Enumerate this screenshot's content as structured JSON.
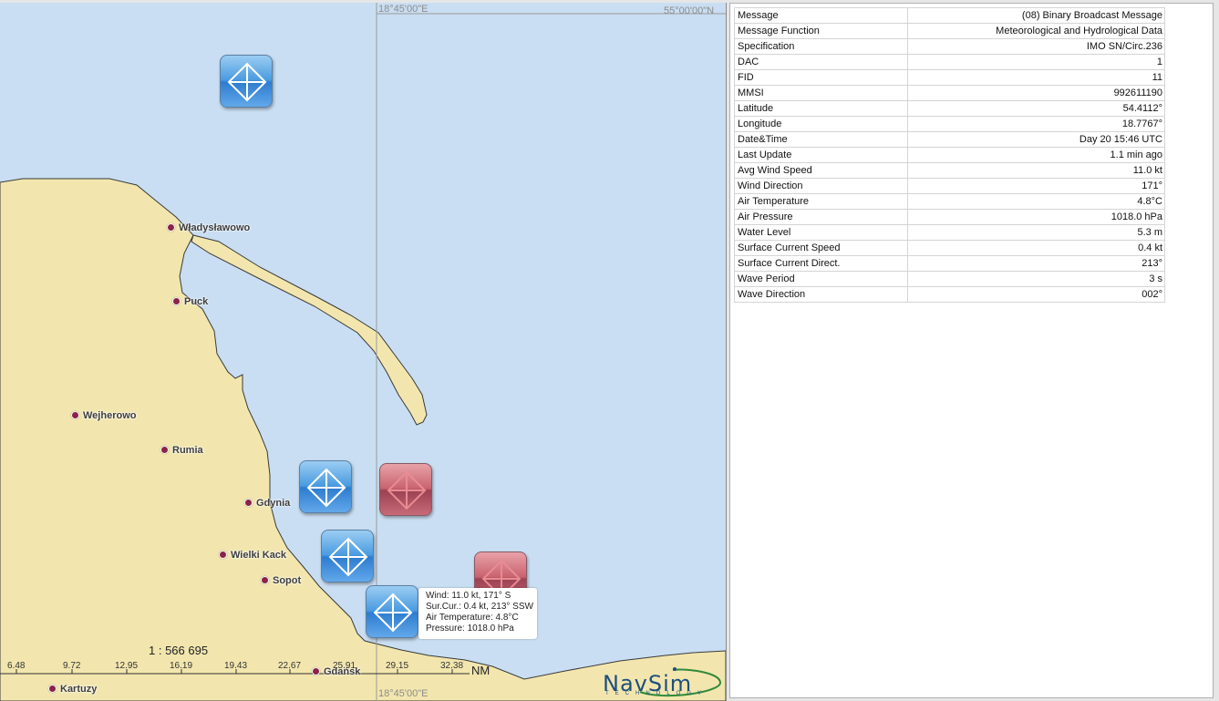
{
  "map": {
    "coord_top": "18°45'00\"E",
    "coord_top_right": "55°00'00\"N",
    "coord_bottom": "18°45'00\"E",
    "towns": [
      {
        "name": "Władysławowo"
      },
      {
        "name": "Puck"
      },
      {
        "name": "Wejherowo"
      },
      {
        "name": "Rumia"
      },
      {
        "name": "Gdynia"
      },
      {
        "name": "Wielki Kack"
      },
      {
        "name": "Sopot"
      },
      {
        "name": "Gdańsk"
      },
      {
        "name": "Kartuzy"
      }
    ],
    "tooltip": {
      "line1": "Wind: 11.0 kt, 171° S",
      "line2": "Sur.Cur.: 0.4 kt, 213° SSW",
      "line3": "Air Temperature: 4.8°C",
      "line4": "Pressure: 1018.0 hPa"
    },
    "scale": {
      "ratio": "1 : 566 695",
      "ticks": [
        "6.48",
        "9.72",
        "12.95",
        "16.19",
        "19.43",
        "22.67",
        "25.91",
        "29.15",
        "32.38"
      ],
      "unit": "NM"
    },
    "logo": {
      "text": "NavSim",
      "sub": "TECHNOLOGY"
    },
    "colors": {
      "sea": "#c9def2",
      "land": "#f2e6ae",
      "buoy_blue": "#3a89d6",
      "buoy_red": "#b8545f"
    }
  },
  "properties": [
    {
      "key": "Message",
      "value": "(08) Binary Broadcast Message"
    },
    {
      "key": "Message Function",
      "value": "Meteorological and Hydrological Data"
    },
    {
      "key": "Specification",
      "value": "IMO SN/Circ.236"
    },
    {
      "key": "DAC",
      "value": "1"
    },
    {
      "key": "FID",
      "value": "11"
    },
    {
      "key": "MMSI",
      "value": "992611190"
    },
    {
      "key": "Latitude",
      "value": "54.4112°"
    },
    {
      "key": "Longitude",
      "value": "18.7767°"
    },
    {
      "key": "Date&Time",
      "value": "Day 20 15:46 UTC"
    },
    {
      "key": "Last Update",
      "value": "1.1 min ago"
    },
    {
      "key": "Avg Wind Speed",
      "value": "11.0 kt"
    },
    {
      "key": "Wind Direction",
      "value": "171°"
    },
    {
      "key": "Air Temperature",
      "value": "4.8°C"
    },
    {
      "key": "Air Pressure",
      "value": "1018.0 hPa"
    },
    {
      "key": "Water Level",
      "value": "5.3 m"
    },
    {
      "key": "Surface Current Speed",
      "value": "0.4 kt"
    },
    {
      "key": "Surface Current Direct.",
      "value": "213°"
    },
    {
      "key": "Wave Period",
      "value": "3 s"
    },
    {
      "key": "Wave Direction",
      "value": "002°"
    }
  ]
}
